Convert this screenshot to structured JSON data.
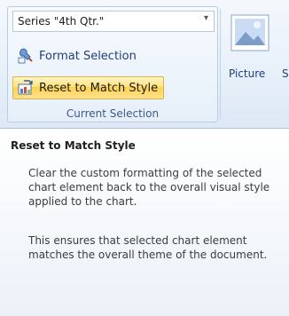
{
  "ribbon": {
    "current_selection": {
      "dropdown_value": "Series \"4th Qtr.\"",
      "format_selection_label": "Format Selection",
      "reset_label": "Reset to Match Style",
      "group_label": "Current Selection"
    },
    "insert": {
      "picture_label": "Picture",
      "cut_label": "S"
    }
  },
  "tooltip": {
    "title": "Reset to Match Style",
    "paragraph1": "Clear the custom formatting of the selected chart element back to the overall visual style applied to the chart.",
    "paragraph2": "This ensures that selected chart element matches the overall theme of the document."
  },
  "colors": {
    "highlight": "#ffe37d",
    "ribbon_text": "#1f3f78",
    "group_border": "#b9cce3"
  },
  "icons": [
    "chevron-down-icon",
    "format-selection-icon",
    "reset-style-icon",
    "picture-icon"
  ]
}
